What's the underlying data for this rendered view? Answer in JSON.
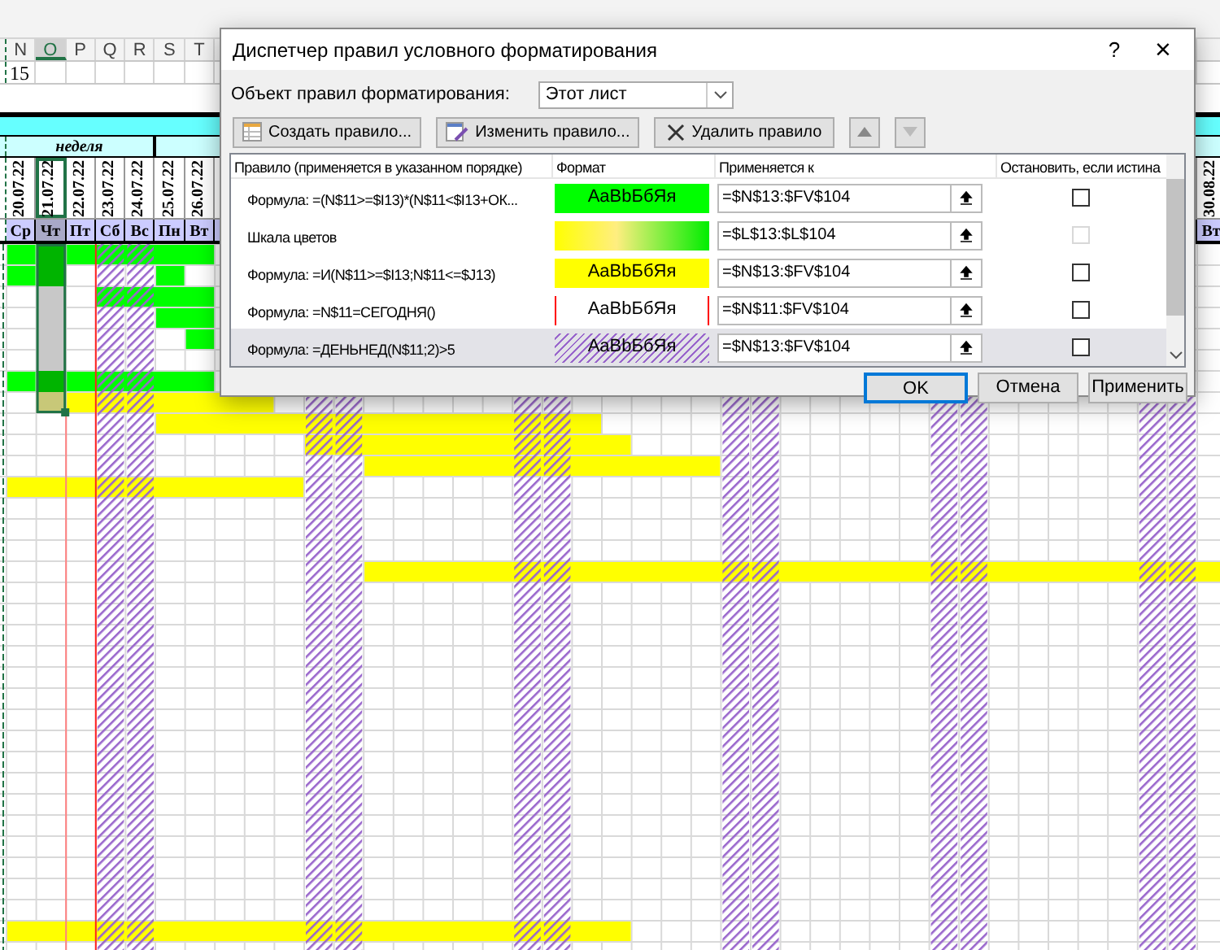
{
  "sheet": {
    "columns": [
      {
        "letter": "N",
        "selected": false
      },
      {
        "letter": "O",
        "selected": true
      },
      {
        "letter": "P",
        "selected": false
      },
      {
        "letter": "Q",
        "selected": false
      },
      {
        "letter": "R",
        "selected": false
      },
      {
        "letter": "S",
        "selected": false
      },
      {
        "letter": "T",
        "selected": false
      }
    ],
    "row_number_cell": "15",
    "week_label": "неделя",
    "days": [
      {
        "date": "20.07.22",
        "day": "Ср",
        "selected": false
      },
      {
        "date": "21.07.22",
        "day": "Чт",
        "selected": true
      },
      {
        "date": "22.07.22",
        "day": "Пт",
        "selected": false
      },
      {
        "date": "23.07.22",
        "day": "Сб",
        "selected": false
      },
      {
        "date": "24.07.22",
        "day": "Вс",
        "selected": false
      },
      {
        "date": "25.07.22",
        "day": "Пн",
        "selected": false
      },
      {
        "date": "26.07.22",
        "day": "Вт",
        "selected": false
      }
    ],
    "edge_day": {
      "date": "30.08.22",
      "day": "Вт"
    }
  },
  "dialog": {
    "title": "Диспетчер правил условного форматирования",
    "help": "?",
    "close": "×",
    "scope_label": "Объект правил форматирования:",
    "scope_value": "Этот лист",
    "toolbar": [
      {
        "label": "Создать правило...",
        "kind": "new"
      },
      {
        "label": "Изменить правило...",
        "kind": "edit"
      },
      {
        "label": "Удалить правило",
        "kind": "delete"
      }
    ],
    "columns": [
      "Правило (применяется в указанном порядке)",
      "Формат",
      "Применяется к",
      "Остановить, если истина"
    ],
    "rules": [
      {
        "rule": "Формула: =(N$11>=$I13)*(N$11<$I13+ОК...",
        "kind": "fill",
        "color": "#00ff00",
        "preview": "AaBbБбЯя",
        "applies_to": "=$N$13:$FV$104",
        "stop_if_true": false,
        "stop_disabled": false,
        "selected": false
      },
      {
        "rule": "Шкала цветов",
        "kind": "scale",
        "applies_to": "=$L$13:$L$104",
        "stop_if_true": false,
        "stop_disabled": true,
        "selected": false
      },
      {
        "rule": "Формула: =И(N$11>=$I13;N$11<=$J13)",
        "kind": "fill",
        "color": "#ffff00",
        "preview": "AaBbБбЯя",
        "applies_to": "=$N$13:$FV$104",
        "stop_if_true": false,
        "stop_disabled": false,
        "selected": false
      },
      {
        "rule": "Формула: =N$11=СЕГОДНЯ()",
        "kind": "border",
        "color": "#ff0000",
        "preview": "AaBbБбЯя",
        "applies_to": "=$N$11:$FV$104",
        "stop_if_true": false,
        "stop_disabled": false,
        "selected": false
      },
      {
        "rule": "Формула: =ДЕНЬНЕД(N$11;2)>5",
        "kind": "hatch",
        "color": "#9966cc",
        "preview": "AaBbБбЯя",
        "applies_to": "=$N$13:$FV$104",
        "stop_if_true": false,
        "stop_disabled": false,
        "selected": true
      }
    ],
    "buttons": [
      {
        "label": "OK",
        "default": true
      },
      {
        "label": "Отмена",
        "default": false
      },
      {
        "label": "Применить",
        "default": false
      }
    ]
  }
}
